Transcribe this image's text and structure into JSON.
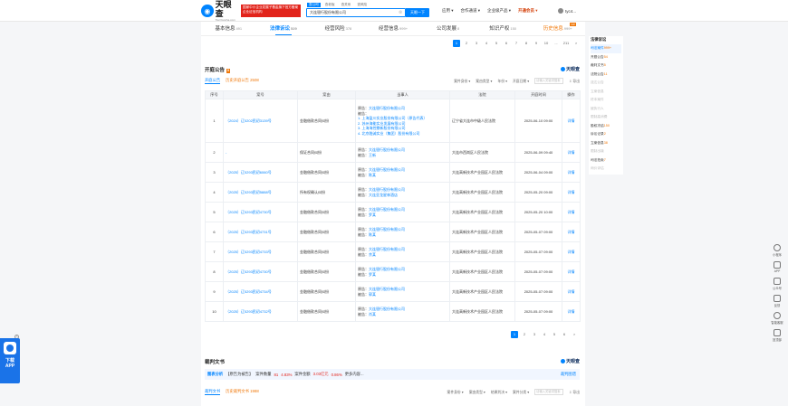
{
  "header": {
    "logo_cn": "天眼查",
    "logo_en": "TianYancha.com",
    "banner_line1": "国家中小企业发展子基金旗下官方备案企业征信机构",
    "banner_line2": "",
    "search_tabs": [
      "查公司",
      "查老板",
      "查关系",
      "查风险"
    ],
    "search_value": "大连银行股份有限公司",
    "search_button": "天眼一下",
    "nav": [
      "应用",
      "合作通道",
      "企业级产品",
      "开通会员"
    ],
    "user": "tyc4..."
  },
  "tabs": [
    {
      "label": "基本信息",
      "count": "491"
    },
    {
      "label": "法律诉讼",
      "count": "529"
    },
    {
      "label": "经营风险",
      "count": "378"
    },
    {
      "label": "经营信息",
      "count": "999+"
    },
    {
      "label": "公司发展",
      "count": "8"
    },
    {
      "label": "知识产权",
      "count": "150"
    },
    {
      "label": "历史信息",
      "count": "999+",
      "badge": "VIP"
    }
  ],
  "pager_top": [
    "1",
    "2",
    "3",
    "4",
    "5",
    "6",
    "7",
    "8",
    "9",
    "10",
    "...",
    "211",
    ">"
  ],
  "hearing": {
    "title": "开庭公告",
    "count": "9",
    "subtabs": [
      "开庭公告",
      "历史开庭公告 2508"
    ],
    "filters": [
      "案件身份",
      "案由类型",
      "年份",
      "开庭日期"
    ],
    "search_placeholder": "请输入关键词搜索",
    "export": "导出",
    "watermark": "天眼查",
    "columns": [
      "序号",
      "案号",
      "案由",
      "当事人",
      "法院",
      "开庭时间",
      "操作"
    ],
    "rows": [
      {
        "no": "1",
        "case": "（2024）辽0202民初3139号",
        "cause": "金融借款合同纠纷",
        "parties": [
          "原告：大连银行股份有限公司",
          "被告：",
          "1. 上海盈川实业股份有限公司（原告代表）",
          "2. 苏州海能实业发展有限公司",
          "3. 上海海控鼎新股份有限公司",
          "4. 北京融诚实业（集团）股份有限公司"
        ],
        "court": "辽宁省大连市中级人民法院",
        "date": "2025-06-10 09:00",
        "op": "详情"
      },
      {
        "no": "2",
        "case": "-",
        "cause": "保证合同纠纷",
        "parties": [
          "原告：大连银行股份有限公司",
          "被告：王新"
        ],
        "court": "大连市西岗区人民法院",
        "date": "2025-06-09 09:40",
        "op": "详情"
      },
      {
        "no": "3",
        "case": "（2025）辽0293民初6060号",
        "cause": "金融借款合同纠纷",
        "parties": [
          "原告：大连银行股份有限公司",
          "被告：陈某"
        ],
        "court": "大连高新技术产业园区人民法院",
        "date": "2025-06-04 09:00",
        "op": "详情"
      },
      {
        "no": "4",
        "case": "（2025）辽0293民初5888号",
        "cause": "所有权确认纠纷",
        "parties": [
          "原告：大连银行股份有限公司",
          "被告：大连亚龙星林酒店"
        ],
        "court": "大连高新技术产业园区人民法院",
        "date": "2025-05-20 09:00",
        "op": "详情"
      },
      {
        "no": "5",
        "case": "（2025）辽0293民初4730号",
        "cause": "金融借款合同纠纷",
        "parties": [
          "原告：大连银行股份有限公司",
          "被告：罗某"
        ],
        "court": "大连高新技术产业园区人民法院",
        "date": "2025-05-20 10:00",
        "op": "详情"
      },
      {
        "no": "6",
        "case": "（2025）辽0293民初4731号",
        "cause": "金融借款合同纠纷",
        "parties": [
          "原告：大连银行股份有限公司",
          "被告：陈某"
        ],
        "court": "大连高新技术产业园区人民法院",
        "date": "2025-05-07 09:00",
        "op": "详情"
      },
      {
        "no": "7",
        "case": "（2025）辽0293民初4733号",
        "cause": "金融借款合同纠纷",
        "parties": [
          "原告：大连银行股份有限公司",
          "被告：余某"
        ],
        "court": "大连高新技术产业园区人民法院",
        "date": "2025-05-07 09:00",
        "op": "详情"
      },
      {
        "no": "8",
        "case": "（2025）辽0293民初4730号",
        "cause": "金融借款合同纠纷",
        "parties": [
          "原告：大连银行股份有限公司",
          "被告：罗某"
        ],
        "court": "大连高新技术产业园区人民法院",
        "date": "2025-05-07 09:00",
        "op": "详情"
      },
      {
        "no": "9",
        "case": "（2025）辽0293民初4734号",
        "cause": "金融借款合同纠纷",
        "parties": [
          "原告：大连银行股份有限公司",
          "被告：郭某"
        ],
        "court": "大连高新技术产业园区人民法院",
        "date": "2025-05-07 09:00",
        "op": "详情"
      },
      {
        "no": "10",
        "case": "（2025）辽0293民初4732号",
        "cause": "金融借款合同纠纷",
        "parties": [
          "原告：大连银行股份有限公司",
          "被告：肖某"
        ],
        "court": "大连高新技术产业园区人民法院",
        "date": "2025-05-07 09:00",
        "op": "详情"
      }
    ]
  },
  "pager_bottom": [
    "1",
    "2",
    "3",
    "4",
    "5",
    "6",
    ">"
  ],
  "judgment": {
    "title": "裁判文书",
    "watermark": "天眼查",
    "analysis_label": "图表分析",
    "analysis_text": "【原告为被告】",
    "analysis_count_label": "案件数量",
    "analysis_count": "81",
    "analysis_pct1": "4.83%",
    "analysis_amount_label": "案件金额",
    "analysis_amount": "3.03亿元",
    "analysis_pct2": "0.86%",
    "analysis_more": "更多内容...",
    "analysis_link": "裁判图谱",
    "subtabs": [
      "裁判文书",
      "历史裁判文书 1988"
    ],
    "filters": [
      "案件身份",
      "案由类型",
      "结果判决",
      "案件分类"
    ],
    "search_placeholder": "请输入关键词搜索",
    "export": "导出"
  },
  "sidebar": {
    "title": "法律诉讼",
    "items": [
      {
        "label": "司法案件",
        "count": "999+",
        "state": "active"
      },
      {
        "label": "开庭公告",
        "count": "54",
        "state": ""
      },
      {
        "label": "裁判文书",
        "count": "5",
        "state": ""
      },
      {
        "label": "法院公告",
        "count": "11",
        "state": ""
      },
      {
        "label": "送达公告",
        "count": "",
        "state": "dim"
      },
      {
        "label": "立案信息",
        "count": "",
        "state": "dim"
      },
      {
        "label": "终本案件",
        "count": "",
        "state": "dim"
      },
      {
        "label": "被执行人",
        "count": "",
        "state": "dim"
      },
      {
        "label": "限制高消费",
        "count": "",
        "state": "dim"
      },
      {
        "label": "股权冻结",
        "count": "150",
        "state": ""
      },
      {
        "label": "诉讼记录",
        "count": "2",
        "state": ""
      },
      {
        "label": "立案信息",
        "count": "38",
        "state": ""
      },
      {
        "label": "限制出境",
        "count": "",
        "state": "dim"
      },
      {
        "label": "司法拍卖",
        "count": "7",
        "state": ""
      },
      {
        "label": "询价评估",
        "count": "",
        "state": "dim"
      }
    ]
  },
  "tools": [
    "小程序",
    "APP",
    "公众号",
    "反馈",
    "智能客服",
    "回顶部"
  ],
  "app_download": {
    "label1": "下载",
    "label2": "APP"
  }
}
